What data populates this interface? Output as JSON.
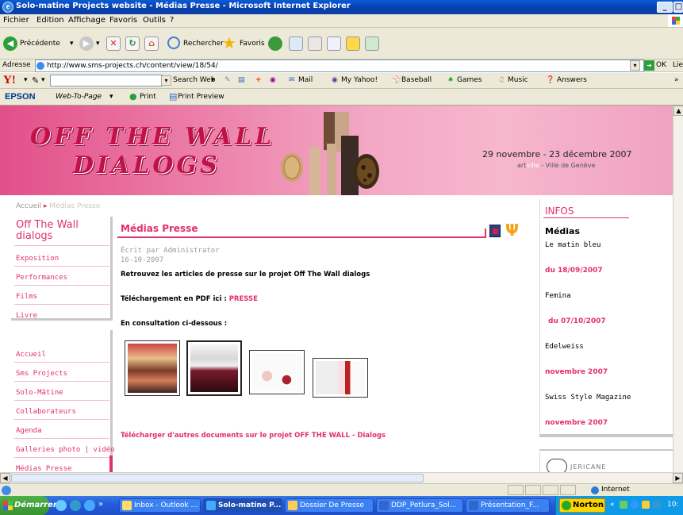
{
  "window": {
    "title": "Solo-matine Projects website - Médias Presse - Microsoft Internet Explorer",
    "min": "_",
    "max": "□"
  },
  "menu": [
    "Fichier",
    "Edition",
    "Affichage",
    "Favoris",
    "Outils",
    "?"
  ],
  "toolbar": {
    "back": "Précédente",
    "search": "Rechercher",
    "favorites": "Favoris"
  },
  "address": {
    "label": "Adresse",
    "url": "http://www.sms-projects.ch/content/view/18/54/",
    "go": "OK",
    "links": "Lie"
  },
  "yahoo": {
    "logo": "Y!",
    "search_button": "Search Web",
    "items": [
      "Mail",
      "My Yahoo!",
      "Baseball",
      "Games",
      "Music",
      "Answers"
    ]
  },
  "epson": {
    "brand": "EPSON",
    "web_to_page": "Web-To-Page",
    "print": "Print",
    "print_preview": "Print Preview"
  },
  "banner": {
    "logo_line1": "OFF THE WALL",
    "logo_line2": "DIALOGS",
    "dates": "29 novembre - 23 décembre 2007",
    "org_prefix": "art",
    "org_mid": "ville",
    "org_suffix": "- Ville de Genève"
  },
  "breadcrumb": {
    "home": "Accueil",
    "current": "Médias Presse"
  },
  "sidebar": {
    "box1_title": "Off The Wall dialogs",
    "box1_items": [
      "Exposition",
      "Performances",
      "Films",
      "Livre"
    ],
    "box2_items": [
      "Accueil",
      "Sms Projects",
      "Solo-Mâtine",
      "Collaborateurs",
      "Agenda",
      "Galleries photo | vidéo",
      "Médias Presse"
    ]
  },
  "article": {
    "title": "Médias Presse",
    "author": "Écrit par Administrator",
    "date": "16-10-2007",
    "intro": "Retrouvez les articles de presse sur le projet Off The Wall dialogs",
    "pdf_prefix": "Téléchargement en PDF ici : ",
    "pdf_link": "PRESSE",
    "consultation": "En consultation ci-dessous :",
    "more_link": "Télécharger d'autres documents sur le projet OFF THE WALL - Dialogs"
  },
  "infos": {
    "title": "INFOS",
    "heading": "Médias",
    "entries": [
      {
        "name": "Le matin bleu",
        "date": "du 18/09/2007"
      },
      {
        "name": "Femina",
        "date": "du 07/10/2007"
      },
      {
        "name": "Edelweiss",
        "date": "novembre 2007"
      },
      {
        "name": "Swiss Style Magazine",
        "date": "novembre 2007"
      }
    ],
    "sponsor": "JERICANE"
  },
  "status": {
    "zone": "Internet"
  },
  "taskbar": {
    "start": "Démarrer",
    "tasks": [
      "Inbox - Outlook ...",
      "Solo-matine P...",
      "Dossier De Presse",
      "DDP_Petlura_Sol...",
      "Présentation_F..."
    ],
    "tray_app": "Norton",
    "clock": "10:"
  },
  "colors": {
    "accent": "#e2306c",
    "xp_blue": "#245edb"
  }
}
